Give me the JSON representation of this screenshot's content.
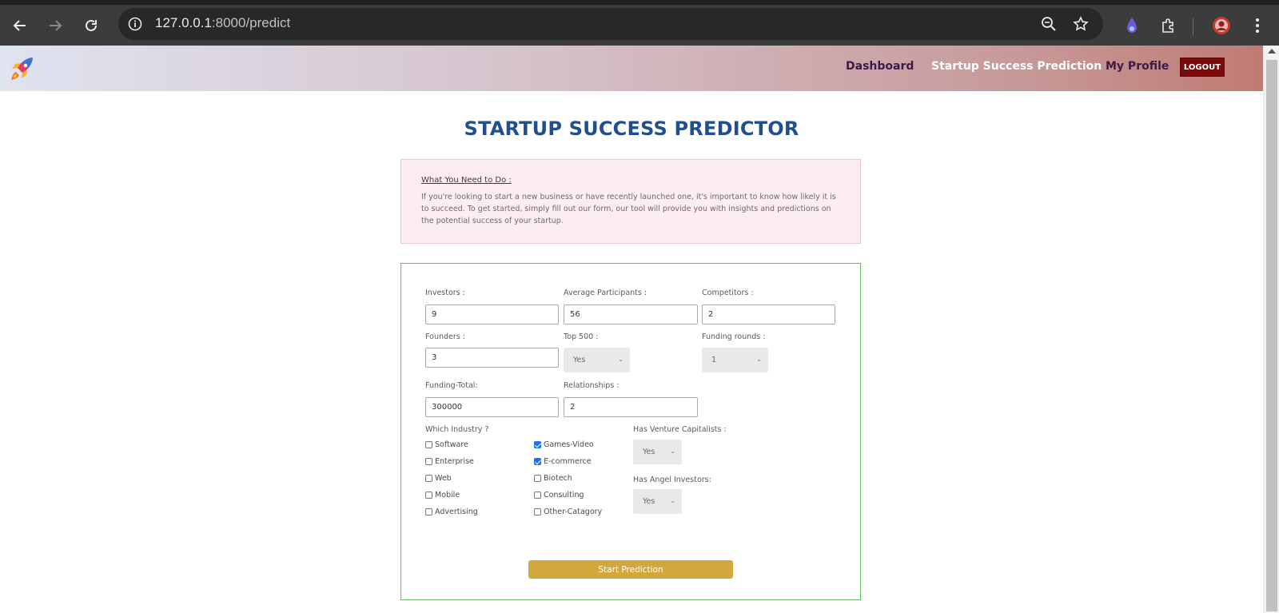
{
  "browser": {
    "url_host": "127.0.0.1",
    "url_path": ":8000/predict",
    "icons": [
      "back-icon",
      "forward-icon",
      "reload-icon",
      "site-info-icon",
      "zoom-icon",
      "bookmark-star-icon",
      "extension-drop-icon",
      "extensions-puzzle-icon",
      "profile-avatar-icon",
      "menu-kebab-icon"
    ]
  },
  "header": {
    "nav": [
      "Dashboard",
      "Startup Success Prediction",
      "My Profile"
    ],
    "logout_label": "LOGOUT"
  },
  "page": {
    "title": "STARTUP SUCCESS PREDICTOR"
  },
  "info": {
    "heading": "What You Need to Do :",
    "text": "If you're looking to start a new business or have recently launched one, it's important to know how likely it is to succeed. To get started, simply fill out our form, our tool will provide you with insights and predictions on the potential success of your startup."
  },
  "form": {
    "investors": {
      "label": "Investors :",
      "value": "9"
    },
    "avg_participants": {
      "label": "Average Participants :",
      "value": "56"
    },
    "competitors": {
      "label": "Competitors :",
      "value": "2"
    },
    "founders": {
      "label": "Founders :",
      "value": "3"
    },
    "top500": {
      "label": "Top 500 :",
      "value": "Yes"
    },
    "funding_rounds": {
      "label": "Funding rounds :",
      "value": "1"
    },
    "funding_total": {
      "label": "Funding-Total:",
      "value": "300000"
    },
    "relationships": {
      "label": "Relationships :",
      "value": "2"
    },
    "industry_label": "Which Industry ?",
    "industries": [
      {
        "label": "Software",
        "checked": false
      },
      {
        "label": "Enterprise",
        "checked": false
      },
      {
        "label": "Web",
        "checked": false
      },
      {
        "label": "Mobile",
        "checked": false
      },
      {
        "label": "Advertising",
        "checked": false
      },
      {
        "label": "Games-Video",
        "checked": true
      },
      {
        "label": "E-commerce",
        "checked": true
      },
      {
        "label": "Biotech",
        "checked": false
      },
      {
        "label": "Consulting",
        "checked": false
      },
      {
        "label": "Other-Catagory",
        "checked": false
      }
    ],
    "has_vc": {
      "label": "Has Venture Capitalists :",
      "value": "Yes"
    },
    "has_angel": {
      "label": "Has Angel Investors:",
      "value": "Yes"
    },
    "submit_label": "Start Prediction"
  }
}
